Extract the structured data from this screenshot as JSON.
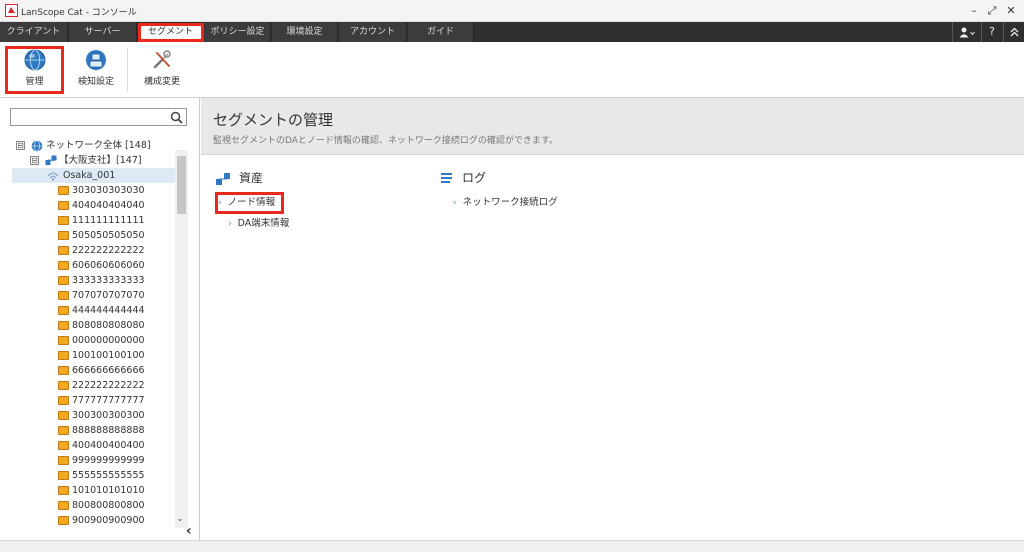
{
  "app": {
    "title": "LanScope Cat - コンソール",
    "logo_color": "#d02a2a"
  },
  "window_controls": {
    "minimize": "–",
    "maximize": "⤢",
    "close": "✕"
  },
  "menu": {
    "tabs": [
      "クライアント",
      "サーバー",
      "セグメント",
      "ポリシー設定",
      "環境設定",
      "アカウント",
      "ガイド"
    ],
    "active_tab": "セグメント",
    "right": {
      "user_icon": "user-icon",
      "help": "?",
      "collapse": "⌃"
    }
  },
  "ribbon": {
    "buttons": [
      {
        "label": "管理",
        "icon": "globe-icon",
        "highlighted": true
      },
      {
        "label": "検知設定",
        "icon": "network-settings-icon",
        "highlighted": false
      },
      {
        "label": "構成変更",
        "icon": "tools-icon",
        "highlighted": false
      }
    ]
  },
  "search": {
    "placeholder": "",
    "value": ""
  },
  "tree": {
    "root": {
      "label": "ネットワーク全体 [148]",
      "expander": "⊟"
    },
    "branch": {
      "label": "【大阪支社】[147]",
      "expander": "⊟"
    },
    "selected": "Osaka_001",
    "items": [
      "303030303030",
      "404040404040",
      "111111111111",
      "505050505050",
      "222222222222",
      "606060606060",
      "333333333333",
      "707070707070",
      "444444444444",
      "808080808080",
      "000000000000",
      "100100100100",
      "666666666666",
      "222222222222",
      "777777777777",
      "300300300300",
      "888888888888",
      "400400400400",
      "999999999999",
      "555555555555",
      "101010101010",
      "800800800800",
      "900900900900"
    ]
  },
  "content": {
    "title": "セグメントの管理",
    "subtitle": "監視セグメントのDAとノード情報の確認、ネットワーク接続ログの確認ができます。",
    "sections": [
      {
        "title": "資産",
        "icon": "network-icon",
        "links": [
          {
            "label": "ノード情報",
            "highlighted": true
          },
          {
            "label": "DA端末情報",
            "highlighted": false
          }
        ]
      },
      {
        "title": "ログ",
        "icon": "log-list-icon",
        "links": [
          {
            "label": "ネットワーク接続ログ",
            "highlighted": false
          }
        ]
      }
    ]
  },
  "colors": {
    "accent": "#e8291c",
    "menubar": "#2f2f2f",
    "link_chevron": "#4a8fd3",
    "header_bg": "#e8e8e8"
  }
}
